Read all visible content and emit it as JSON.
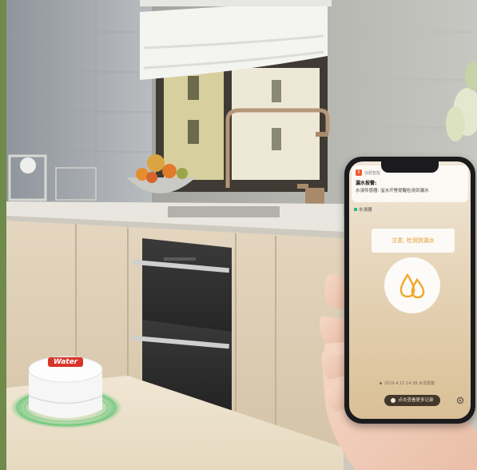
{
  "device": {
    "label": "Water"
  },
  "phone": {
    "notification": {
      "app_name": "涂鸦智能",
      "title": "漏水报警:",
      "body": "水浸传感器: 溢水开警提醒检测到漏水"
    },
    "app_tag": "水浸器",
    "alert_banner": "注意, 检测到漏水",
    "timestamp": "2019.4.12 14:38 水浸报警",
    "record_button": "点击查看更多记录",
    "icons": [
      "droplets-icon",
      "settings-icon",
      "info-icon"
    ]
  },
  "colors": {
    "accent_drop": "#f0a92e",
    "phone_frame": "#1b1b1d",
    "sensor_ring": "#3fbf5f",
    "sensor_label": "#d8352a"
  }
}
